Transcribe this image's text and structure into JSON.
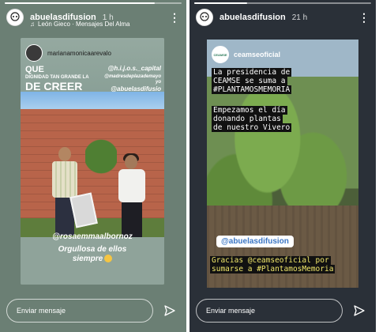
{
  "stories": [
    {
      "progress": 0.85,
      "username": "abuelasdifusion",
      "time": "1 h",
      "music": "León Gieco · Mensajes Del Alma",
      "content": {
        "tag_user": "marianamonicaarevalo",
        "headline_line1": "QUE",
        "headline_line2": "DIGNIDAD TAN GRANDE LA",
        "headline_line3": "DE CREER",
        "right_tags": [
          "@h.i.j.o.s._capital",
          "@madresdeplazademayo",
          "yo",
          "@abuelasdifusio"
        ],
        "mention": "@rosaemmaalbornoz",
        "caption_line1": "Orgullosa de ellos",
        "caption_line2": "siempre"
      },
      "reply_placeholder": "Enviar mensaje"
    },
    {
      "progress": 0.3,
      "username": "abuelasdifusion",
      "time": "21 h",
      "content": {
        "tag_user": "ceamseoficial",
        "text_block_1": [
          "La presidencia de",
          "CEAMSE se suma a",
          "#PLANTAMOSMEMORIA"
        ],
        "text_block_2": [
          "Empezamos el día",
          "donando plantas",
          "de nuestro Vivero"
        ],
        "mention": "@abuelasdifusion",
        "text_block_3": [
          "Gracias @ceamseoficial por",
          "sumarse a #PlantamosMemoria"
        ]
      },
      "reply_placeholder": "Enviar mensaje"
    }
  ],
  "colors": {
    "bg_panel_1": "#6b7f74",
    "bg_panel_2": "#2a3038",
    "mention_blue": "#3b76c4"
  },
  "icons": [
    "skull-logo-icon",
    "more-vert-icon",
    "music-note-icon",
    "send-icon"
  ]
}
